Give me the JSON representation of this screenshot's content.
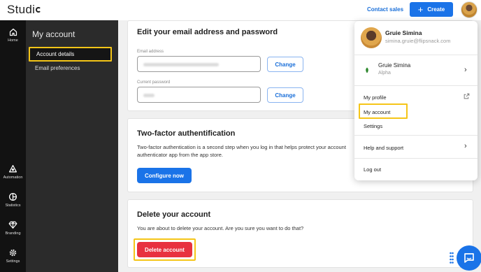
{
  "topbar": {
    "logo_text": "Studi",
    "contact_link": "Contact sales",
    "create_button": "Create",
    "create_icon": "+"
  },
  "rail": {
    "items": [
      {
        "label": "Home",
        "icon": "home-icon"
      },
      {
        "label": "Automation",
        "icon": "automation-icon"
      },
      {
        "label": "Statistics",
        "icon": "statistics-icon"
      },
      {
        "label": "Branding",
        "icon": "diamond-icon"
      },
      {
        "label": "Settings",
        "icon": "gear-icon"
      }
    ]
  },
  "subsidebar": {
    "title": "My account",
    "items": [
      {
        "label": "Account details",
        "active": true
      },
      {
        "label": "Email preferences",
        "active": false
      }
    ]
  },
  "email_password": {
    "title": "Edit your email address and password",
    "email_label": "Email address",
    "password_label": "Current password",
    "change_email_button": "Change",
    "change_password_button": "Change"
  },
  "two_factor": {
    "title": "Two-factor authentification",
    "description_line1": "Two-factor authentication is a second step when you log in that helps protect your account",
    "description_line2": "authenticator app from the app store.",
    "button": "Configure now"
  },
  "delete_account": {
    "title": "Delete your account",
    "description": "You are about to delete your account. Are you sure you want to do that?",
    "button": "Delete account"
  },
  "dropdown": {
    "user_name": "Gruie Simina",
    "user_email": "simina.gruie@flipsnack.com",
    "workspace_name": "Gruie Simina",
    "workspace_plan": "Alpha",
    "my_profile": "My profile",
    "my_account": "My account",
    "settings": "Settings",
    "help_support": "Help and support",
    "log_out": "Log out"
  },
  "colors": {
    "primary": "#1a73e8",
    "danger": "#e8313f",
    "highlight": "#f5c518",
    "rail": "#121212",
    "subsidebar": "#2b2b2b"
  }
}
